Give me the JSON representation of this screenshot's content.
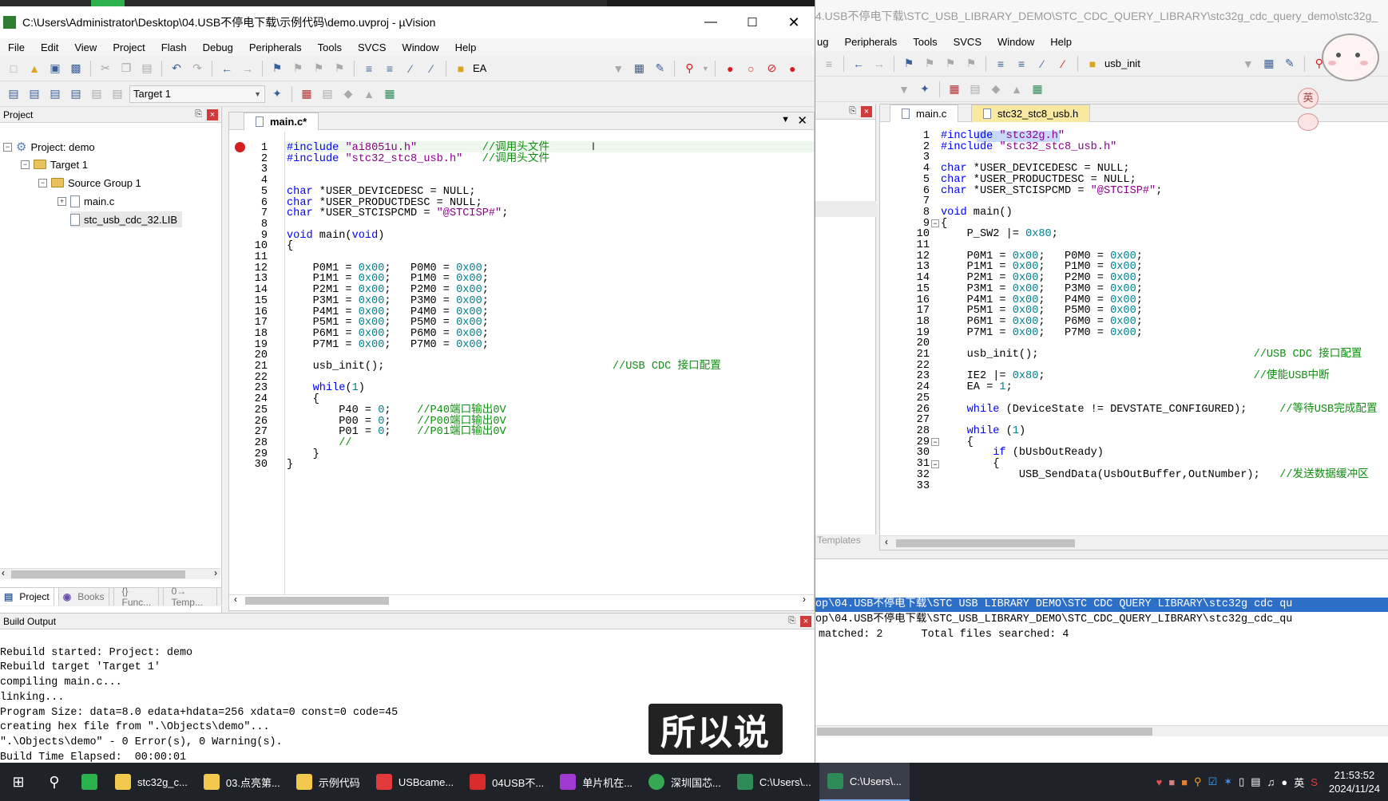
{
  "left_window": {
    "title": "C:\\Users\\Administrator\\Desktop\\04.USB不停电下载\\示例代码\\demo.uvproj - µVision",
    "menu": [
      "File",
      "Edit",
      "View",
      "Project",
      "Flash",
      "Debug",
      "Peripherals",
      "Tools",
      "SVCS",
      "Window",
      "Help"
    ],
    "toolbar_combo": "EA",
    "target_combo": "Target 1",
    "project_panel": {
      "title": "Project",
      "root": "Project: demo",
      "target": "Target 1",
      "group": "Source Group 1",
      "files": [
        "main.c",
        "stc_usb_cdc_32.LIB"
      ],
      "bottom_tabs": [
        "Project",
        "Books",
        "{} Func...",
        "0→ Temp..."
      ]
    },
    "editor": {
      "tab": "main.c*",
      "line_numbers": [
        "1",
        "2",
        "3",
        "4",
        "5",
        "6",
        "7",
        "8",
        "9",
        "10",
        "11",
        "12",
        "13",
        "14",
        "15",
        "16",
        "17",
        "18",
        "19",
        "20",
        "21",
        "22",
        "23",
        "24",
        "25",
        "26",
        "27",
        "28",
        "29",
        "30"
      ]
    },
    "build_output": {
      "title": "Build Output",
      "lines": [
        "Rebuild started: Project: demo",
        "Rebuild target 'Target 1'",
        "compiling main.c...",
        "linking...",
        "Program Size: data=8.0 edata+hdata=256 xdata=0 const=0 code=45",
        "creating hex file from \".\\Objects\\demo\"...",
        "\".\\Objects\\demo\" - 0 Error(s), 0 Warning(s).",
        "Build Time Elapsed:  00:00:01"
      ]
    }
  },
  "right_window": {
    "title": "4.USB不停电下载\\STC_USB_LIBRARY_DEMO\\STC_CDC_QUERY_LIBRARY\\stc32g_cdc_query_demo\\stc32g_",
    "menu": [
      "ug",
      "Peripherals",
      "Tools",
      "SVCS",
      "Window",
      "Help"
    ],
    "toolbar_combo": "usb_init",
    "tabs": [
      "main.c",
      "stc32_stc8_usb.h"
    ],
    "side_label": "Templates",
    "line_numbers": [
      "1",
      "2",
      "3",
      "4",
      "5",
      "6",
      "7",
      "8",
      "9",
      "10",
      "11",
      "12",
      "13",
      "14",
      "15",
      "16",
      "17",
      "18",
      "19",
      "20",
      "21",
      "22",
      "23",
      "24",
      "25",
      "26",
      "27",
      "28",
      "29",
      "30",
      "31",
      "32",
      "33"
    ],
    "find_results": [
      "op\\04.USB不停电下载\\STC USB LIBRARY DEMO\\STC CDC QUERY LIBRARY\\stc32g cdc qu",
      "op\\04.USB不停电下载\\STC_USB_LIBRARY_DEMO\\STC_CDC_QUERY_LIBRARY\\stc32g_cdc_qu",
      "matched: 2      Total files searched: 4"
    ]
  },
  "subtitle": "所以说",
  "taskbar": {
    "apps": [
      {
        "label": "stc32g_c...",
        "color": "#f2c94c"
      },
      {
        "label": "03.点亮第...",
        "color": "#f2c94c"
      },
      {
        "label": "示例代码",
        "color": "#f2c94c"
      },
      {
        "label": "USBcame...",
        "color": "#e03a3a"
      },
      {
        "label": "04USB不...",
        "color": "#d92b2b"
      },
      {
        "label": "单片机在...",
        "color": "#a03ad0"
      },
      {
        "label": "深圳国芯...",
        "color": "#34a853"
      },
      {
        "label": "C:\\Users\\...",
        "color": "#2e8b57"
      },
      {
        "label": "C:\\Users\\...",
        "color": "#2e8b57"
      }
    ],
    "ime": "英",
    "time": "21:53:52",
    "date": "2024/11/24"
  }
}
